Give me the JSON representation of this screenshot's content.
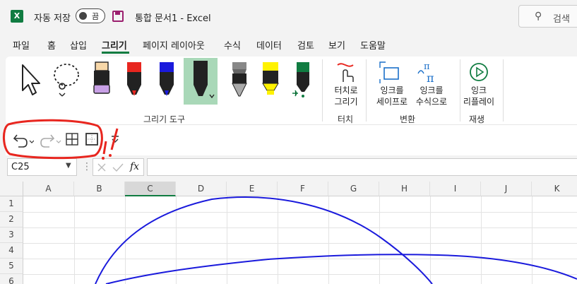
{
  "titlebar": {
    "logo": "X",
    "autosave_label": "자동 저장",
    "autosave_state": "끔",
    "doc_title": "통합 문서1  -  Excel",
    "search_label": "검색"
  },
  "tabs": [
    {
      "label": "파일"
    },
    {
      "label": "홈"
    },
    {
      "label": "삽입"
    },
    {
      "label": "그리기",
      "active": true
    },
    {
      "label": "페이지 레이아웃"
    },
    {
      "label": "수식"
    },
    {
      "label": "데이터"
    },
    {
      "label": "검토"
    },
    {
      "label": "보기"
    },
    {
      "label": "도움말"
    }
  ],
  "ribbon": {
    "drawing_tools_label": "그리기 도구",
    "touch_button": "터치로\n그리기",
    "touch_group": "터치",
    "ink_to_shape": "잉크를\n세이프로",
    "ink_to_math": "잉크를\n수식으로",
    "convert_group": "변환",
    "ink_replay": "잉크\n리플레이",
    "replay_group": "재생"
  },
  "colors": {
    "accent": "#107c41",
    "ink_red": "#e8261f",
    "ink_blue": "#1a1adc"
  },
  "formula_bar": {
    "namebox": "C25",
    "fx": "fx",
    "formula": ""
  },
  "grid": {
    "columns": [
      "A",
      "B",
      "C",
      "D",
      "E",
      "F",
      "G",
      "H",
      "I",
      "J",
      "K"
    ],
    "rows": [
      "1",
      "2",
      "3",
      "4",
      "5",
      "6"
    ],
    "selected_column": "C"
  }
}
